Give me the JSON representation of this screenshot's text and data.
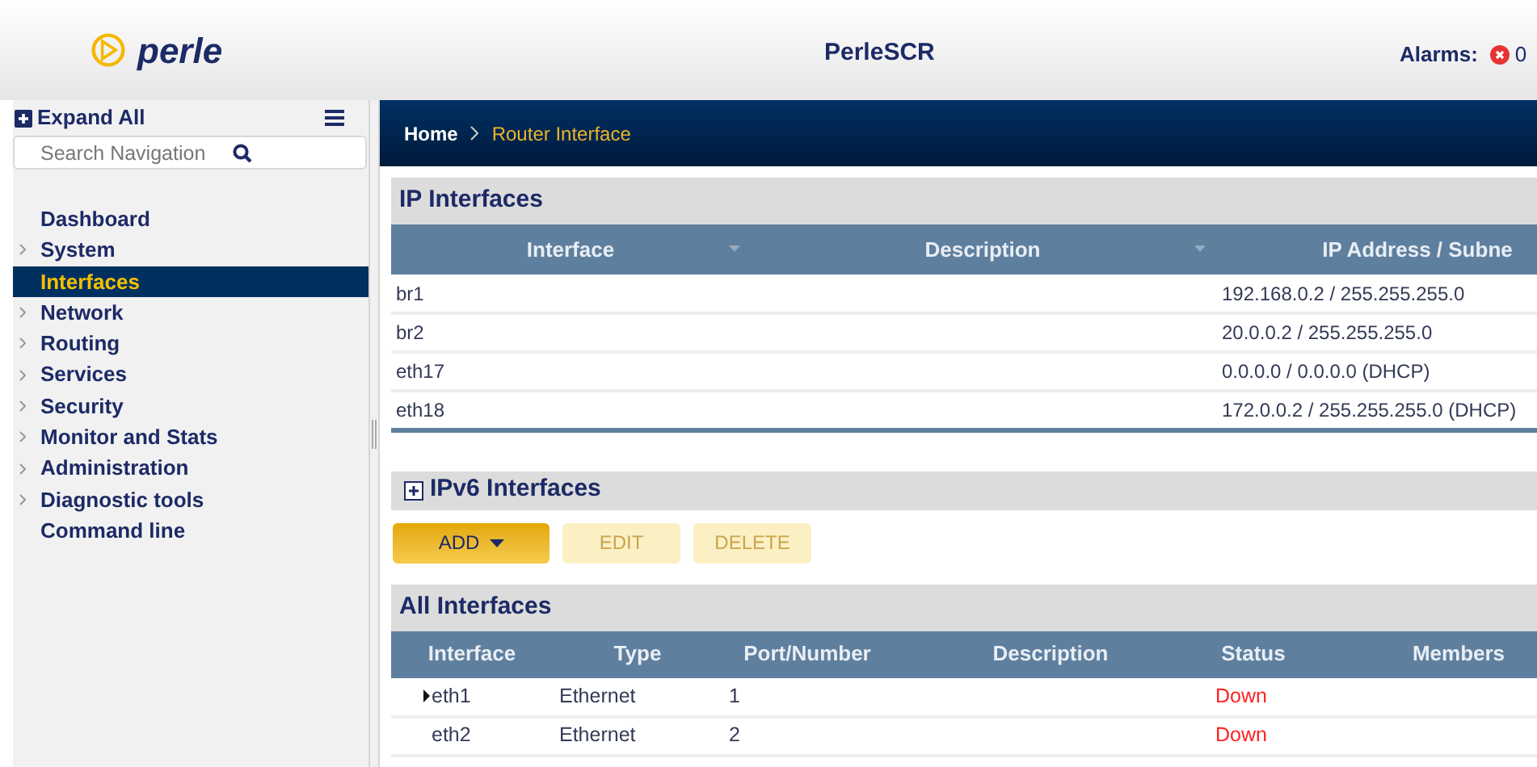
{
  "header": {
    "logo_text": "perle",
    "title": "PerleSCR",
    "alarms_label": "Alarms:",
    "alarms_count": "0"
  },
  "sidebar": {
    "expand_all": "Expand All",
    "search": {
      "placeholder": "Search Navigation"
    },
    "items": [
      {
        "label": "Dashboard",
        "expandable": false,
        "selected": false
      },
      {
        "label": "System",
        "expandable": true,
        "selected": false
      },
      {
        "label": "Interfaces",
        "expandable": false,
        "selected": true
      },
      {
        "label": "Network",
        "expandable": true,
        "selected": false
      },
      {
        "label": "Routing",
        "expandable": true,
        "selected": false
      },
      {
        "label": "Services",
        "expandable": true,
        "selected": false
      },
      {
        "label": "Security",
        "expandable": true,
        "selected": false
      },
      {
        "label": "Monitor and Stats",
        "expandable": true,
        "selected": false
      },
      {
        "label": "Administration",
        "expandable": true,
        "selected": false
      },
      {
        "label": "Diagnostic tools",
        "expandable": true,
        "selected": false
      },
      {
        "label": "Command line",
        "expandable": false,
        "selected": false
      }
    ]
  },
  "breadcrumb": [
    "Home",
    "Router Interface"
  ],
  "ip_interfaces": {
    "title": "IP Interfaces",
    "columns": [
      "Interface",
      "Description",
      "IP Address / Subne"
    ],
    "rows": [
      [
        "br1",
        "",
        "192.168.0.2 / 255.255.255.0"
      ],
      [
        "br2",
        "",
        "20.0.0.2 / 255.255.255.0"
      ],
      [
        "eth17",
        "",
        "0.0.0.0 / 0.0.0.0 (DHCP)"
      ],
      [
        "eth18",
        "",
        "172.0.0.2 / 255.255.255.0 (DHCP)"
      ]
    ]
  },
  "ipv6_interfaces": {
    "title": "IPv6 Interfaces",
    "expanded": false
  },
  "buttons": [
    {
      "label": "ADD",
      "disabled": false,
      "dropdown": true
    },
    {
      "label": "EDIT",
      "disabled": true,
      "dropdown": false
    },
    {
      "label": "DELETE",
      "disabled": true,
      "dropdown": false
    }
  ],
  "all_interfaces": {
    "title": "All Interfaces",
    "columns": [
      "Interface",
      "Type",
      "Port/Number",
      "Description",
      "Status",
      "Members"
    ],
    "rows": [
      {
        "interface": "eth1",
        "expandable": true,
        "type": "Ethernet",
        "port": "1",
        "description": "",
        "status": "Down"
      },
      {
        "interface": "eth2",
        "expandable": false,
        "type": "Ethernet",
        "port": "2",
        "description": "",
        "status": "Down"
      }
    ]
  }
}
